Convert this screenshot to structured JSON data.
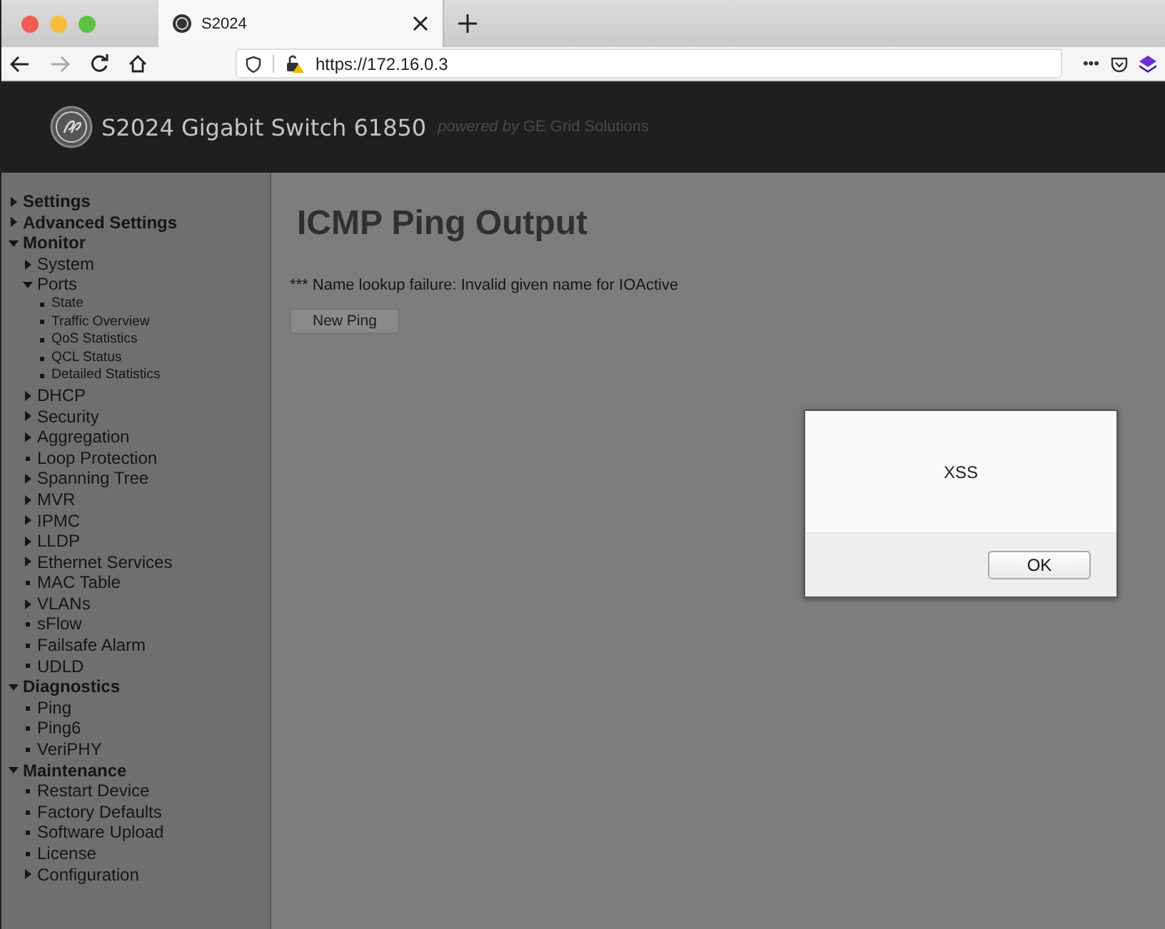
{
  "browser": {
    "tab": {
      "title": "S2024",
      "selected": true
    },
    "url": "https://172.16.0.3",
    "menu_dots": "•••"
  },
  "header": {
    "title": "S2024 Gigabit Switch 61850",
    "powered_by": "powered by",
    "vendor": "GE Grid Solutions"
  },
  "sidebar": {
    "items": [
      {
        "label": "Settings",
        "kind": "folder",
        "expanded": false
      },
      {
        "label": "Advanced Settings",
        "kind": "folder",
        "expanded": false
      },
      {
        "label": "Monitor",
        "kind": "folder",
        "expanded": true,
        "children": [
          {
            "label": "System",
            "kind": "folder",
            "expanded": false
          },
          {
            "label": "Ports",
            "kind": "folder",
            "expanded": true,
            "children": [
              {
                "label": "State",
                "kind": "leaf"
              },
              {
                "label": "Traffic Overview",
                "kind": "leaf"
              },
              {
                "label": "QoS Statistics",
                "kind": "leaf"
              },
              {
                "label": "QCL Status",
                "kind": "leaf"
              },
              {
                "label": "Detailed Statistics",
                "kind": "leaf"
              }
            ]
          },
          {
            "label": "DHCP",
            "kind": "folder",
            "expanded": false
          },
          {
            "label": "Security",
            "kind": "folder",
            "expanded": false
          },
          {
            "label": "Aggregation",
            "kind": "folder",
            "expanded": false
          },
          {
            "label": "Loop Protection",
            "kind": "leaf"
          },
          {
            "label": "Spanning Tree",
            "kind": "folder",
            "expanded": false
          },
          {
            "label": "MVR",
            "kind": "folder",
            "expanded": false
          },
          {
            "label": "IPMC",
            "kind": "folder",
            "expanded": false
          },
          {
            "label": "LLDP",
            "kind": "folder",
            "expanded": false
          },
          {
            "label": "Ethernet Services",
            "kind": "folder",
            "expanded": false
          },
          {
            "label": "MAC Table",
            "kind": "leaf"
          },
          {
            "label": "VLANs",
            "kind": "folder",
            "expanded": false
          },
          {
            "label": "sFlow",
            "kind": "leaf"
          },
          {
            "label": "Failsafe Alarm",
            "kind": "leaf"
          },
          {
            "label": "UDLD",
            "kind": "leaf"
          }
        ]
      },
      {
        "label": "Diagnostics",
        "kind": "folder",
        "expanded": true,
        "children": [
          {
            "label": "Ping",
            "kind": "leaf"
          },
          {
            "label": "Ping6",
            "kind": "leaf"
          },
          {
            "label": "VeriPHY",
            "kind": "leaf"
          }
        ]
      },
      {
        "label": "Maintenance",
        "kind": "folder",
        "expanded": true,
        "children": [
          {
            "label": "Restart Device",
            "kind": "leaf"
          },
          {
            "label": "Factory Defaults",
            "kind": "leaf"
          },
          {
            "label": "Software Upload",
            "kind": "leaf"
          },
          {
            "label": "License",
            "kind": "leaf"
          },
          {
            "label": "Configuration",
            "kind": "folder",
            "expanded": false
          }
        ]
      }
    ]
  },
  "main": {
    "heading": "ICMP Ping Output",
    "message": "*** Name lookup failure: Invalid given name for IOActive",
    "button": "New Ping"
  },
  "dialog": {
    "message": "XSS",
    "button": "OK"
  }
}
